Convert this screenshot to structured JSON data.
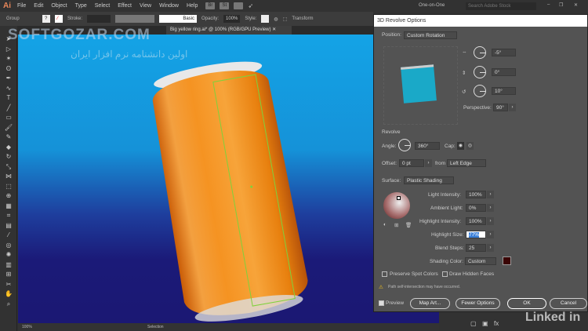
{
  "app": {
    "logo": "Ai",
    "menu": [
      "File",
      "Edit",
      "Object",
      "Type",
      "Select",
      "Effect",
      "View",
      "Window",
      "Help"
    ],
    "bridge": "Br",
    "stock": "St"
  },
  "workspace": "One-on-One",
  "search_placeholder": "Search Adobe Stock",
  "control": {
    "selection": "Group",
    "stroke_label": "Stroke:",
    "brush": "Basic",
    "opacity_label": "Opacity:",
    "opacity": "100%",
    "style_label": "Style:",
    "transform": "Transform"
  },
  "document_tab": "Big yellow ring.ai* @ 100% (RGB/GPU Preview)",
  "watermark": {
    "text": "SOFTGOZAR.COM",
    "subtitle": "اولین دانشنامه نرم افزار ایران"
  },
  "status": {
    "zoom": "100%",
    "tool": "Selection"
  },
  "dialog": {
    "title": "3D Revolve Options",
    "position_label": "Position:",
    "position": "Custom Rotation",
    "rot_x": "-5°",
    "rot_y": "0°",
    "rot_z": "10°",
    "perspective_label": "Perspective:",
    "perspective": "90°",
    "revolve_heading": "Revolve",
    "angle_label": "Angle:",
    "angle": "360°",
    "cap_label": "Cap:",
    "offset_label": "Offset:",
    "offset": "0 pt",
    "from_label": "from",
    "from": "Left Edge",
    "surface_label": "Surface:",
    "surface": "Plastic Shading",
    "light_intensity_label": "Light Intensity:",
    "light_intensity": "100%",
    "ambient_label": "Ambient Light:",
    "ambient": "0%",
    "highlight_intensity_label": "Highlight Intensity:",
    "highlight_intensity": "100%",
    "highlight_size_label": "Highlight Size:",
    "highlight_size": "77%",
    "blend_steps_label": "Blend Steps:",
    "blend_steps": "25",
    "shading_color_label": "Shading Color:",
    "shading_color": "Custom",
    "shading_swatch": "#3a0505",
    "preserve_spot": "Preserve Spot Colors",
    "draw_hidden": "Draw Hidden Faces",
    "warning": "Path self-intersection may have occurred.",
    "preview": "Preview",
    "map_art": "Map Art...",
    "fewer_options": "Fewer Options",
    "ok": "OK",
    "cancel": "Cancel"
  },
  "brand": "Linked in"
}
